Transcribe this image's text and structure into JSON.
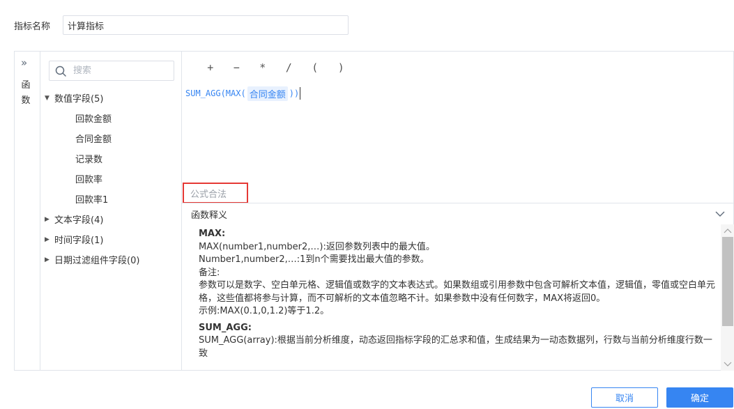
{
  "indicator": {
    "label": "指标名称",
    "value": "计算指标"
  },
  "function_rail": {
    "label": "函数"
  },
  "search": {
    "placeholder": "搜索"
  },
  "tree": {
    "groups": [
      {
        "label": "数值字段(5)",
        "expanded": true,
        "items": [
          "回款金额",
          "合同金额",
          "记录数",
          "回款率",
          "回款率1"
        ]
      },
      {
        "label": "文本字段(4)",
        "expanded": false,
        "items": []
      },
      {
        "label": "时间字段(1)",
        "expanded": false,
        "items": []
      },
      {
        "label": "日期过滤组件字段(0)",
        "expanded": false,
        "items": []
      }
    ]
  },
  "operators": [
    "+",
    "−",
    "*",
    "/",
    "(",
    ")"
  ],
  "formula": {
    "prefix": "SUM_AGG(MAX(",
    "token": "合同金额",
    "suffix": "))"
  },
  "validation": {
    "text": "公式合法",
    "status_color": "#e53935"
  },
  "explain": {
    "header": "函数释义",
    "blocks": [
      {
        "title": "MAX:",
        "lines": [
          "MAX(number1,number2,…):返回参数列表中的最大值。",
          "Number1,number2,…:1到n个需要找出最大值的参数。",
          "备注:",
          "参数可以是数字、空白单元格、逻辑值或数字的文本表达式。如果数组或引用参数中包含可解析文本值，逻辑值，零值或空白单元格，这些值都将参与计算，而不可解析的文本值忽略不计。如果参数中没有任何数字，MAX将返回0。",
          "示例:MAX(0.1,0,1.2)等于1.2。"
        ]
      },
      {
        "title": "SUM_AGG:",
        "lines": [
          "SUM_AGG(array):根据当前分析维度，动态返回指标字段的汇总求和值，生成结果为一动态数据列，行数与当前分析维度行数一致"
        ]
      }
    ]
  },
  "buttons": {
    "cancel": "取消",
    "ok": "确定"
  },
  "colors": {
    "accent": "#3685f2",
    "border": "#e0e4ea"
  }
}
